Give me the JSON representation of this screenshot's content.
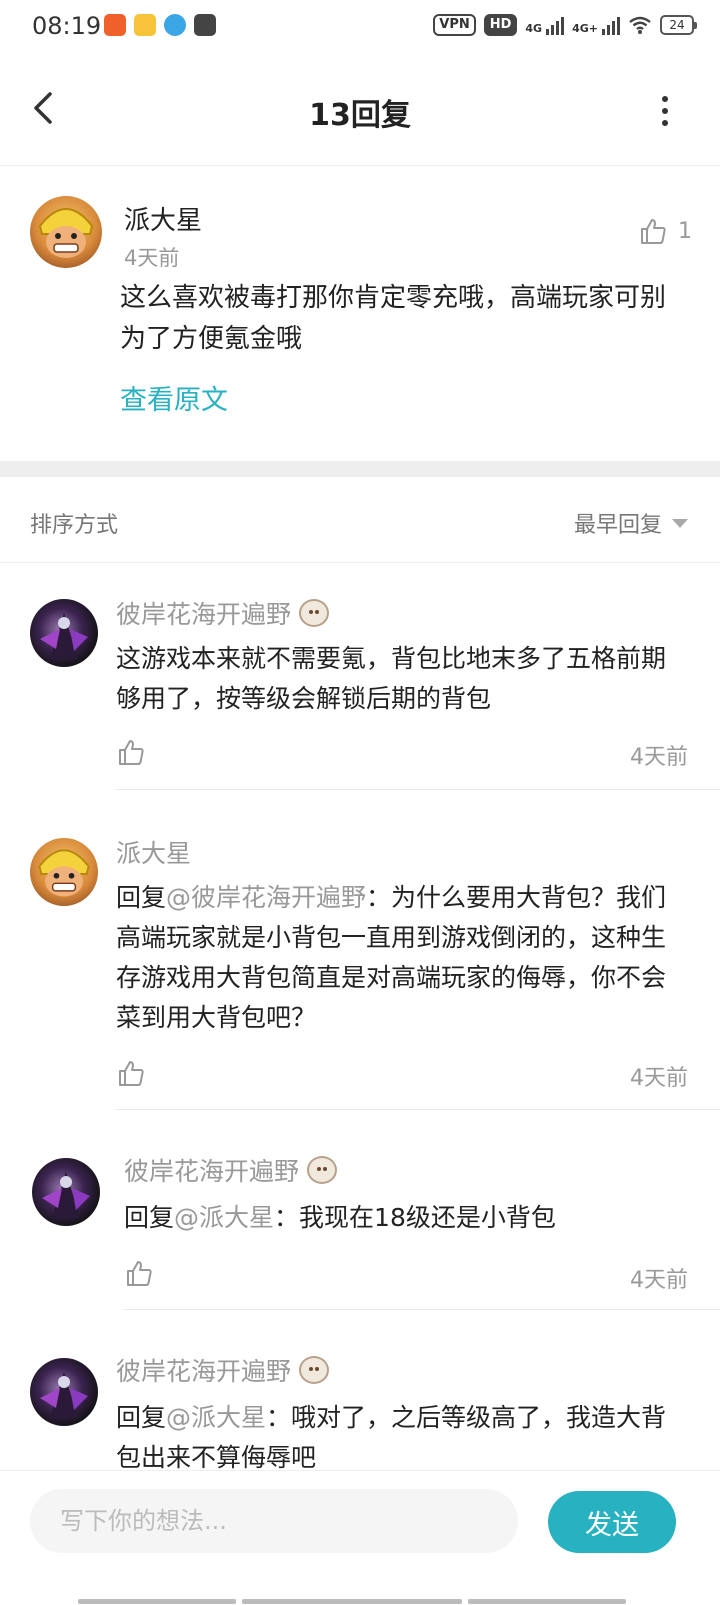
{
  "status_bar": {
    "time": "08:19",
    "vpn": "VPN",
    "hd": "HD",
    "net1": "4G",
    "net2": "4G+",
    "battery": "24",
    "app_icons": [
      "taobao-app-icon",
      "jd-app-icon",
      "edge-browser-icon",
      "gallery-app-icon"
    ]
  },
  "header": {
    "title": "13回复",
    "back_icon": "chevron-left-icon",
    "more_icon": "more-vertical-icon"
  },
  "main_comment": {
    "author": "派大星",
    "time": "4天前",
    "likes": "1",
    "text": "这么喜欢被毒打那你肯定零充哦，高端玩家可别为了方便氪金哦",
    "view_original": "查看原文"
  },
  "sort": {
    "label": "排序方式",
    "value": "最早回复"
  },
  "replies": [
    {
      "author": "彼岸花海开遍野",
      "has_badge": true,
      "prefix": "",
      "mention": "",
      "separator": "",
      "text": "这游戏本来就不需要氪，背包比地末多了五格前期够用了，按等级会解锁后期的背包",
      "time": "4天前"
    },
    {
      "author": "派大星",
      "has_badge": false,
      "prefix": "回复",
      "mention": "@彼岸花海开遍野",
      "separator": "：",
      "text": "为什么要用大背包？我们高端玩家就是小背包一直用到游戏倒闭的，这种生存游戏用大背包简直是对高端玩家的侮辱，你不会菜到用大背包吧？",
      "time": "4天前"
    },
    {
      "author": "彼岸花海开遍野",
      "has_badge": true,
      "prefix": "回复",
      "mention": "@派大星",
      "separator": "：",
      "text": "我现在18级还是小背包",
      "time": "4天前"
    },
    {
      "author": "彼岸花海开遍野",
      "has_badge": true,
      "prefix": "回复",
      "mention": "@派大星",
      "separator": "：",
      "text": "哦对了，之后等级高了，我造大背包出来不算侮辱吧",
      "time": ""
    }
  ],
  "composer": {
    "placeholder": "写下你的想法...",
    "send_label": "发送"
  },
  "colors": {
    "accent": "#27b1c1",
    "muted_text": "#999999",
    "body_text": "#222222"
  }
}
